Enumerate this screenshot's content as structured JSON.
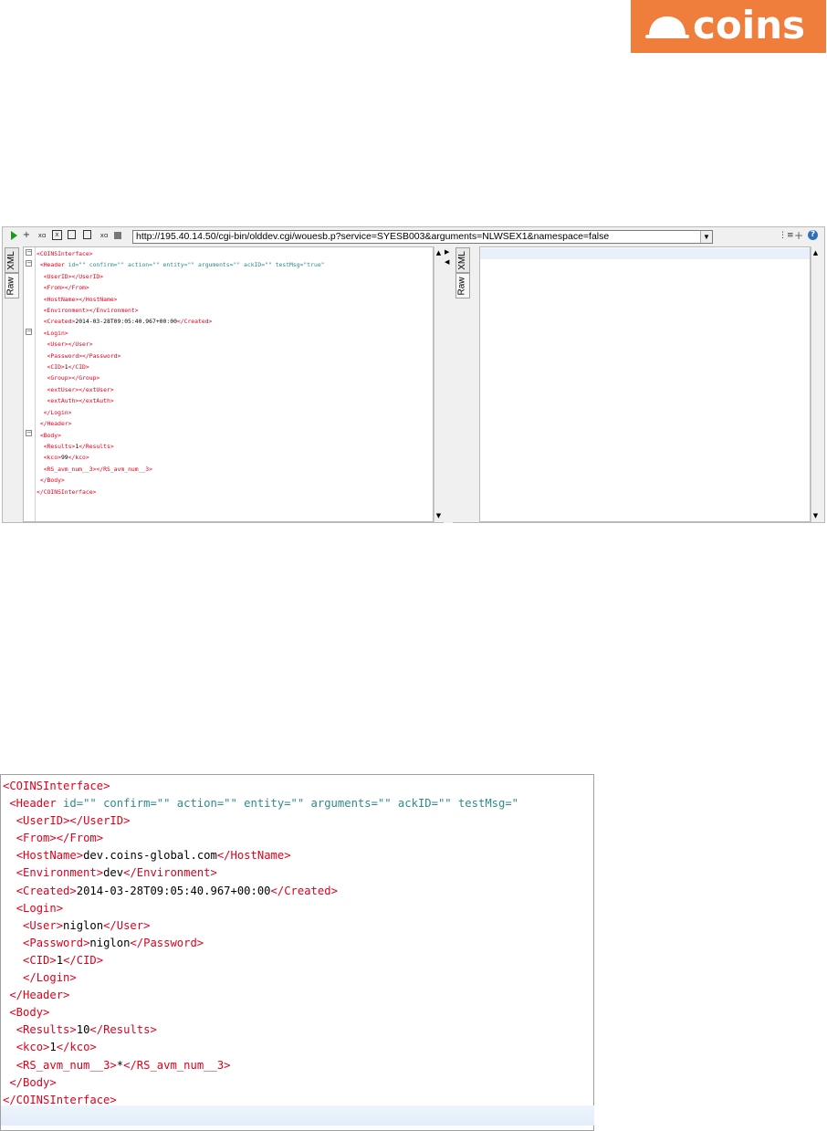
{
  "logo": {
    "text": "coins",
    "color": "#ef7d3b"
  },
  "toolbar": {
    "url": "http://195.40.14.50/cgi-bin/olddev.cgi/wouesb.p?service=SYESB003&arguments=NLWSEX1&namespace=false",
    "icons": [
      "play-icon",
      "add-line-icon",
      "format-icon",
      "xml-icon",
      "copy-icon",
      "copy2-icon",
      "code-icon",
      "stop-icon"
    ],
    "right_icons": [
      "tree-icon",
      "plus-icon",
      "help-icon"
    ]
  },
  "tabs": {
    "xml": "XML",
    "raw": "Raw"
  },
  "small_xml": [
    {
      "indent": 0,
      "open": "COINSInterface",
      "text": "",
      "close": null
    },
    {
      "indent": 1,
      "open": "Header",
      "attrs": " id=\"\" confirm=\"\" action=\"\" entity=\"\" arguments=\"\" ackID=\"\" testMsg=\"true\"",
      "close": null
    },
    {
      "indent": 2,
      "open": "UserID",
      "text": "",
      "close": "UserID"
    },
    {
      "indent": 2,
      "open": "From",
      "text": "",
      "close": "From"
    },
    {
      "indent": 2,
      "open": "HostName",
      "text": "",
      "close": "HostName"
    },
    {
      "indent": 2,
      "open": "Environment",
      "text": "",
      "close": "Environment"
    },
    {
      "indent": 2,
      "open": "Created",
      "text": "2014-03-28T09:05:40.967+00:00",
      "close": "Created"
    },
    {
      "indent": 2,
      "open": "Login",
      "text": "",
      "close": null
    },
    {
      "indent": 3,
      "open": "User",
      "text": "",
      "close": "User"
    },
    {
      "indent": 3,
      "open": "Password",
      "text": "",
      "close": "Password"
    },
    {
      "indent": 3,
      "open": "CID",
      "text": "1",
      "close": "CID"
    },
    {
      "indent": 3,
      "open": "Group",
      "text": "",
      "close": "Group"
    },
    {
      "indent": 3,
      "open": "extUser",
      "text": "",
      "close": "extUser"
    },
    {
      "indent": 3,
      "open": "extAuth",
      "text": "",
      "close": "extAuth"
    },
    {
      "indent": 2,
      "open": null,
      "text": "",
      "close": "Login"
    },
    {
      "indent": 1,
      "open": null,
      "text": "",
      "close": "Header"
    },
    {
      "indent": 1,
      "open": "Body",
      "text": "",
      "close": null
    },
    {
      "indent": 2,
      "open": "Results",
      "text": "1",
      "close": "Results"
    },
    {
      "indent": 2,
      "open": "kco",
      "text": "99",
      "close": "kco"
    },
    {
      "indent": 2,
      "open": "RS_avm_num__3",
      "text": "",
      "close": "RS_avm_num__3"
    },
    {
      "indent": 1,
      "open": null,
      "text": "",
      "close": "Body"
    },
    {
      "indent": 0,
      "open": null,
      "text": "",
      "close": "COINSInterface"
    }
  ],
  "big_xml": [
    {
      "indent": 0,
      "open": "COINSInterface",
      "text": "",
      "close": null
    },
    {
      "indent": 1,
      "open": "Header",
      "attrs": " id=\"\" confirm=\"\" action=\"\" entity=\"\" arguments=\"\" ackID=\"\" testMsg=\"",
      "close": null
    },
    {
      "indent": 2,
      "open": "UserID",
      "text": "",
      "close": "UserID"
    },
    {
      "indent": 2,
      "open": "From",
      "text": "",
      "close": "From"
    },
    {
      "indent": 2,
      "open": "HostName",
      "text": "dev.coins-global.com",
      "close": "HostName"
    },
    {
      "indent": 2,
      "open": "Environment",
      "text": "dev",
      "close": "Environment"
    },
    {
      "indent": 2,
      "open": "Created",
      "text": "2014-03-28T09:05:40.967+00:00",
      "close": "Created"
    },
    {
      "indent": 2,
      "open": "Login",
      "text": "",
      "close": null
    },
    {
      "indent": 3,
      "open": "User",
      "text": "niglon",
      "close": "User"
    },
    {
      "indent": 3,
      "open": "Password",
      "text": "niglon",
      "close": "Password"
    },
    {
      "indent": 3,
      "open": "CID",
      "text": "1",
      "close": "CID"
    },
    {
      "indent": 3,
      "open": null,
      "text": "",
      "close": "Login"
    },
    {
      "indent": 1,
      "open": null,
      "text": "",
      "close": "Header"
    },
    {
      "indent": 1,
      "open": "Body",
      "text": "",
      "close": null
    },
    {
      "indent": 2,
      "open": "Results",
      "text": "10",
      "close": "Results"
    },
    {
      "indent": 2,
      "open": "kco",
      "text": "1",
      "close": "kco"
    },
    {
      "indent": 2,
      "open": "RS_avm_num__3",
      "text": "*",
      "close": "RS_avm_num__3"
    },
    {
      "indent": 1,
      "open": null,
      "text": "",
      "close": "Body"
    },
    {
      "indent": 0,
      "open": null,
      "text": "",
      "close": "COINSInterface"
    }
  ]
}
